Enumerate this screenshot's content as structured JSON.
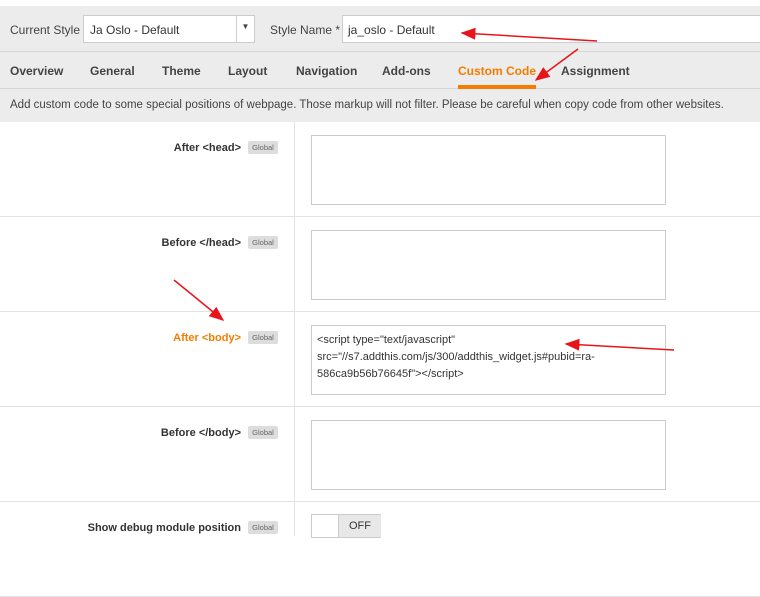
{
  "header": {
    "current_style_label": "Current Style",
    "current_style_value": "Ja Oslo - Default",
    "style_name_label": "Style Name *",
    "style_name_value": "ja_oslo - Default"
  },
  "tabs": [
    {
      "label": "Overview"
    },
    {
      "label": "General"
    },
    {
      "label": "Theme"
    },
    {
      "label": "Layout"
    },
    {
      "label": "Navigation"
    },
    {
      "label": "Add-ons"
    },
    {
      "label": "Custom Code"
    },
    {
      "label": "Assignment"
    }
  ],
  "description": "Add custom code to some special positions of webpage. Those markup will not filter. Please be careful when copy code from other websites.",
  "rows": [
    {
      "label": "After <head>",
      "badge": "Global",
      "value": ""
    },
    {
      "label": "Before </head>",
      "badge": "Global",
      "value": ""
    },
    {
      "label": "After <body>",
      "badge": "Global",
      "value": "<script type=\"text/javascript\" src=\"//s7.addthis.com/js/300/addthis_widget.js#pubid=ra-586ca9b56b76645f\"></script>"
    },
    {
      "label": "Before </body>",
      "badge": "Global",
      "value": ""
    },
    {
      "label": "Show debug module position",
      "badge": "Global",
      "toggle": "OFF"
    }
  ],
  "colors": {
    "accent": "#f57c00",
    "annotation": "#e8141b"
  }
}
